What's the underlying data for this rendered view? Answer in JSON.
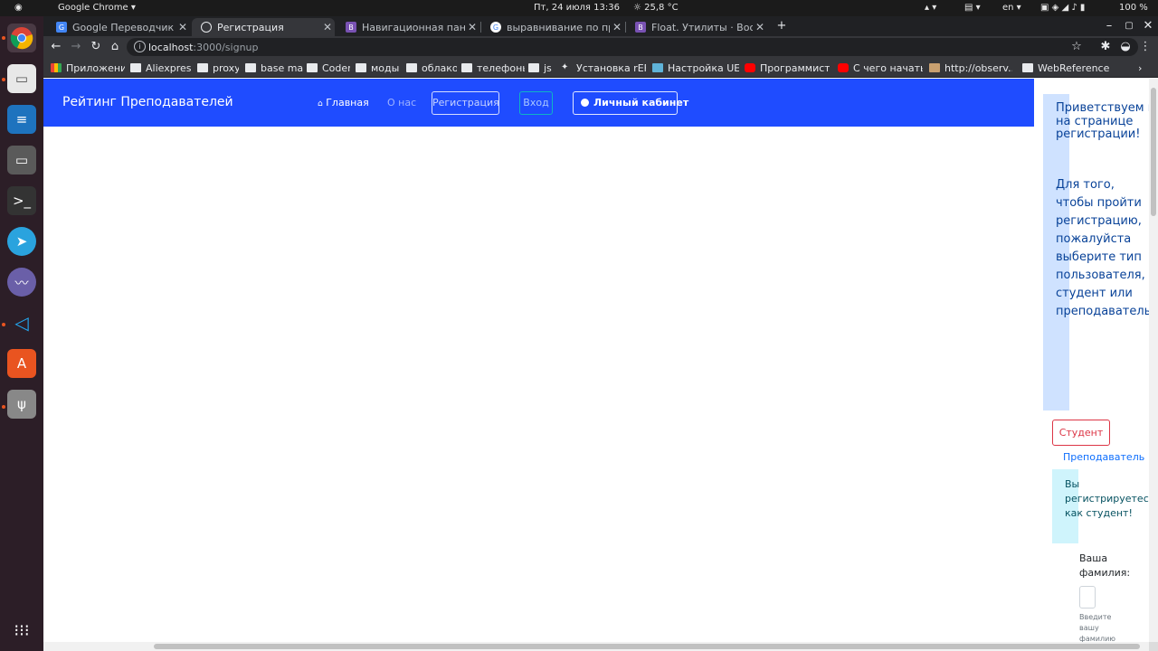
{
  "system": {
    "app_name": "Google Chrome",
    "datetime": "Пт, 24 июля  13:36",
    "weather": "25,8 °C",
    "language": "en",
    "battery": "100 %"
  },
  "tabs": [
    {
      "title": "Google Переводчик"
    },
    {
      "title": "Регистрация"
    },
    {
      "title": "Навигационная панель"
    },
    {
      "title": "выравнивание по правому"
    },
    {
      "title": "Float. Утилиты · Bootstrap"
    }
  ],
  "address_bar": {
    "host": "localhost",
    "path": ":3000/signup"
  },
  "bookmarks": [
    {
      "label": "Приложения"
    },
    {
      "label": "Aliexpress"
    },
    {
      "label": "proxy"
    },
    {
      "label": "base mail"
    },
    {
      "label": "Coder"
    },
    {
      "label": "моды"
    },
    {
      "label": "облако"
    },
    {
      "label": "телефоны"
    },
    {
      "label": "js"
    },
    {
      "label": "Установка rEF..."
    },
    {
      "label": "Настройка UE..."
    },
    {
      "label": "Программист..."
    },
    {
      "label": "С чего начать..."
    },
    {
      "label": "http://observ..."
    },
    {
      "label": "WebReference"
    }
  ],
  "navbar": {
    "brand": "Рейтинг Преподавателей",
    "home": "Главная",
    "about": "О нас",
    "signup": "Регистрация",
    "login": "Вход",
    "cabinet": "Личный кабинет"
  },
  "signup": {
    "greeting": "Приветствуем вас на странице регистрации!",
    "instruction": "Для того, чтобы пройти регистрацию, пожалуйста выберите тип пользователя, студент или преподаватель.",
    "student_button": "Студент",
    "teacher_link": "Преподаватель",
    "role_notice": "Вы регистрируетесь как студент!",
    "surname_label": "Ваша фамилия:",
    "surname_help": "Введите вашу фамилию"
  },
  "colors": {
    "navbar_bg": "#1f4cff",
    "alert_primary_bg": "#cfe2ff",
    "alert_info_bg": "#cff4fc",
    "danger": "#dc3545"
  }
}
